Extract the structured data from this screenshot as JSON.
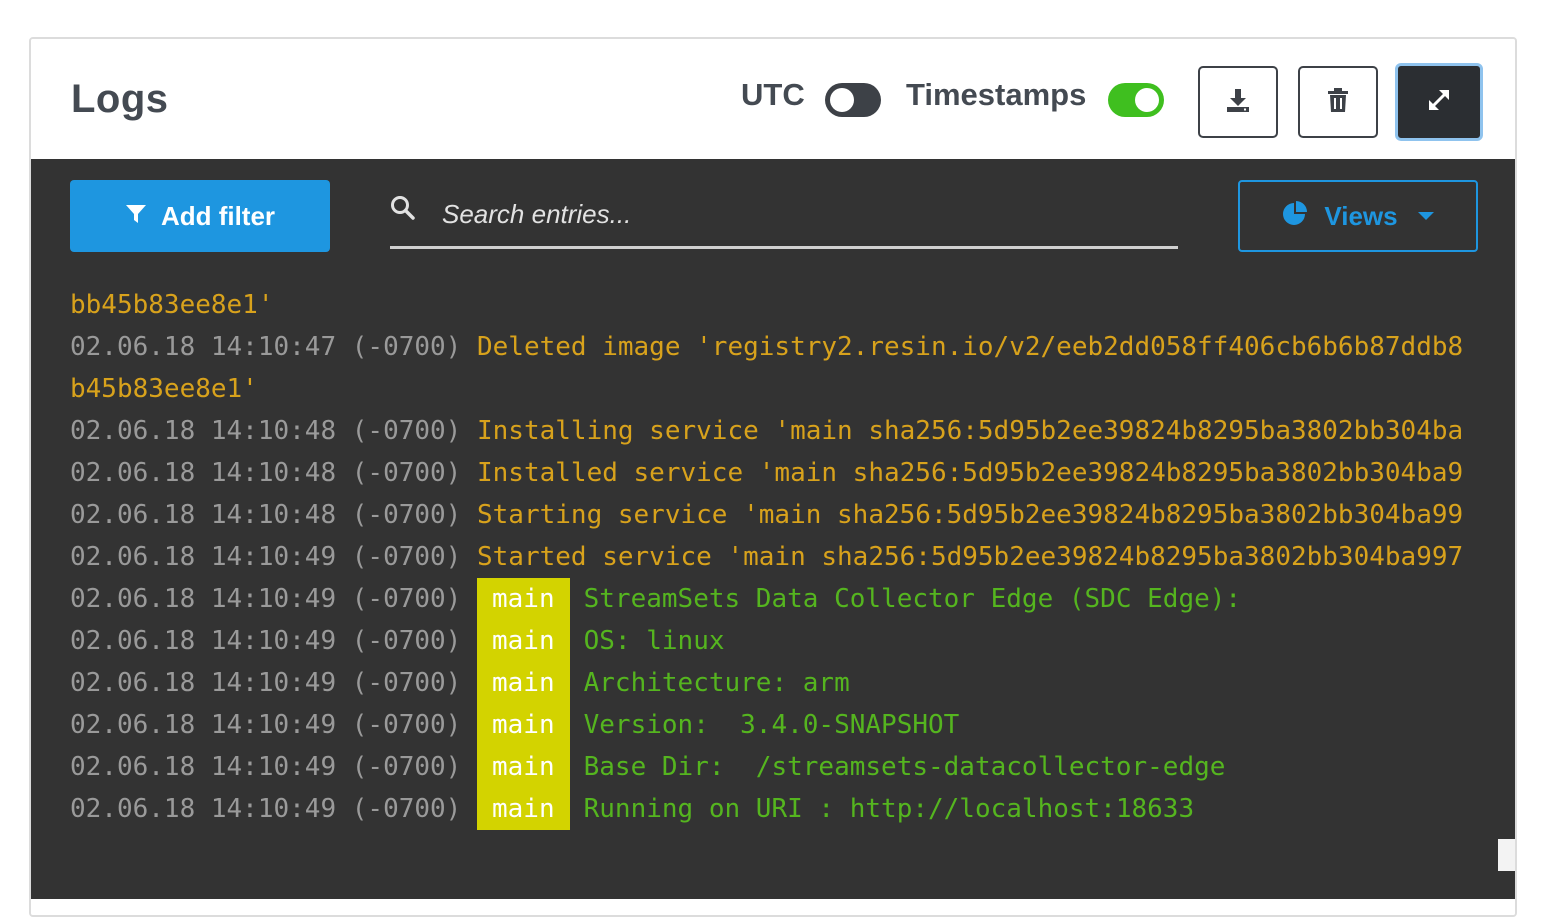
{
  "header": {
    "title": "Logs",
    "utc_label": "UTC",
    "utc_enabled": false,
    "timestamps_label": "Timestamps",
    "timestamps_enabled": true
  },
  "toolbar": {
    "download_icon": "download-icon",
    "delete_icon": "trash-icon",
    "expand_icon": "expand-icon"
  },
  "filters": {
    "add_filter_label": "Add filter",
    "search_placeholder": "Search entries...",
    "views_label": "Views"
  },
  "colors": {
    "accent": "#1e96e0",
    "log_background": "#333333",
    "timestamp": "#9a9a9a",
    "system_message": "#d8a21c",
    "service_message": "#55b51f",
    "service_tag": "#d3d300",
    "toggle_on": "#3fbf1f"
  },
  "log_lines": [
    {
      "timestamp": "",
      "tag": "",
      "message": "bb45b83ee8e1'",
      "kind": "system"
    },
    {
      "timestamp": "02.06.18 14:10:47 (-0700)",
      "tag": "",
      "message": "Deleted image 'registry2.resin.io/v2/eeb2dd058ff406cb6b6b87ddb8",
      "kind": "system"
    },
    {
      "timestamp": "",
      "tag": "",
      "message": "b45b83ee8e1'",
      "kind": "system"
    },
    {
      "timestamp": "02.06.18 14:10:48 (-0700)",
      "tag": "",
      "message": "Installing service 'main sha256:5d95b2ee39824b8295ba3802bb304ba",
      "kind": "system"
    },
    {
      "timestamp": "02.06.18 14:10:48 (-0700)",
      "tag": "",
      "message": "Installed service 'main sha256:5d95b2ee39824b8295ba3802bb304ba9",
      "kind": "system"
    },
    {
      "timestamp": "02.06.18 14:10:48 (-0700)",
      "tag": "",
      "message": "Starting service 'main sha256:5d95b2ee39824b8295ba3802bb304ba99",
      "kind": "system"
    },
    {
      "timestamp": "02.06.18 14:10:49 (-0700)",
      "tag": "",
      "message": "Started service 'main sha256:5d95b2ee39824b8295ba3802bb304ba997",
      "kind": "system"
    },
    {
      "timestamp": "02.06.18 14:10:49 (-0700)",
      "tag": "main",
      "message": "StreamSets Data Collector Edge (SDC Edge):",
      "kind": "service"
    },
    {
      "timestamp": "02.06.18 14:10:49 (-0700)",
      "tag": "main",
      "message": "OS: linux",
      "kind": "service"
    },
    {
      "timestamp": "02.06.18 14:10:49 (-0700)",
      "tag": "main",
      "message": "Architecture: arm",
      "kind": "service"
    },
    {
      "timestamp": "02.06.18 14:10:49 (-0700)",
      "tag": "main",
      "message": "Version:  3.4.0-SNAPSHOT",
      "kind": "service"
    },
    {
      "timestamp": "02.06.18 14:10:49 (-0700)",
      "tag": "main",
      "message": "Base Dir:  /streamsets-datacollector-edge",
      "kind": "service"
    },
    {
      "timestamp": "02.06.18 14:10:49 (-0700)",
      "tag": "main",
      "message": "Running on URI : http://localhost:18633",
      "kind": "service"
    }
  ]
}
